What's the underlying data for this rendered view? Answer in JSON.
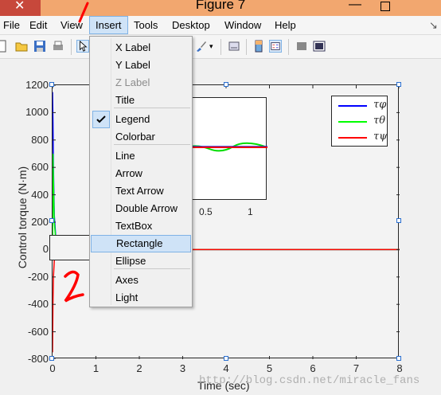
{
  "window": {
    "title": "Figure 7",
    "minimize_glyph": "—",
    "close_glyph": "✕"
  },
  "menubar": {
    "items": [
      "File",
      "Edit",
      "View",
      "Insert",
      "Tools",
      "Desktop",
      "Window",
      "Help"
    ],
    "active": "Insert",
    "overflow_glyph": "↘"
  },
  "insert_menu": {
    "items": [
      {
        "label": "X Label",
        "enabled": true
      },
      {
        "label": "Y Label",
        "enabled": true
      },
      {
        "label": "Z Label",
        "enabled": false
      },
      {
        "label": "Title",
        "enabled": true
      },
      {
        "label": "Legend",
        "enabled": true,
        "checked": true
      },
      {
        "label": "Colorbar",
        "enabled": true
      },
      {
        "label": "Line",
        "enabled": true
      },
      {
        "label": "Arrow",
        "enabled": true
      },
      {
        "label": "Text Arrow",
        "enabled": true
      },
      {
        "label": "Double Arrow",
        "enabled": true
      },
      {
        "label": "TextBox",
        "enabled": true
      },
      {
        "label": "Rectangle",
        "enabled": true,
        "highlighted": true
      },
      {
        "label": "Ellipse",
        "enabled": true
      },
      {
        "label": "Axes",
        "enabled": true
      },
      {
        "label": "Light",
        "enabled": true
      }
    ]
  },
  "toolbar": {
    "icons": [
      "new-figure-icon",
      "open-file-icon",
      "save-icon",
      "print-icon",
      "edit-plot-pointer-icon",
      "brush-icon",
      "link-plot-icon",
      "insert-colorbar-icon",
      "insert-legend-icon",
      "hide-plot-tools-icon",
      "show-plot-tools-icon"
    ]
  },
  "chart_data": {
    "type": "line",
    "xlabel": "Time (sec)",
    "ylabel": "Control torque (N·m)",
    "xlim": [
      0,
      8
    ],
    "ylim": [
      -800,
      1200
    ],
    "xticks": [
      "0",
      "1",
      "2",
      "3",
      "4",
      "5",
      "6",
      "7",
      "8"
    ],
    "yticks": [
      "1200",
      "1000",
      "800",
      "600",
      "400",
      "200",
      "0",
      "-200",
      "-400",
      "-600",
      "-800"
    ],
    "grid": false,
    "legend_position": "top-right",
    "series": [
      {
        "name": "τφ",
        "color": "#0000ff",
        "x": [
          0,
          0.01,
          0.02,
          0.04,
          0.08,
          0.15,
          0.3,
          0.6,
          1,
          2,
          4,
          6,
          8
        ],
        "y": [
          1150,
          950,
          600,
          250,
          60,
          10,
          -5,
          2,
          0,
          0,
          0,
          0,
          0
        ]
      },
      {
        "name": "τθ",
        "color": "#00ff00",
        "x": [
          0,
          0.01,
          0.02,
          0.04,
          0.08,
          0.15,
          0.3,
          0.6,
          1,
          2,
          4,
          6,
          8
        ],
        "y": [
          -50,
          700,
          500,
          200,
          50,
          15,
          5,
          0,
          0,
          0,
          0,
          0,
          0
        ]
      },
      {
        "name": "τψ",
        "color": "#ff0000",
        "x": [
          0,
          0.01,
          0.02,
          0.04,
          0.08,
          0.15,
          0.3,
          0.6,
          1,
          2,
          4,
          6,
          8
        ],
        "y": [
          -750,
          -400,
          -200,
          -80,
          -20,
          -5,
          0,
          0,
          0,
          0,
          0,
          0,
          0
        ]
      }
    ],
    "inset": {
      "xticks": [
        "0.5",
        "1"
      ]
    }
  },
  "annotations": {
    "mark_1": "/",
    "mark_2": "2"
  },
  "watermark": "http://blog.csdn.net/miracle_fans",
  "colors": {
    "titlebar": "#f2a76f",
    "close_button": "#c7483b",
    "menu_highlight": "#cfe3f7",
    "annotation_red": "#ff0000"
  }
}
